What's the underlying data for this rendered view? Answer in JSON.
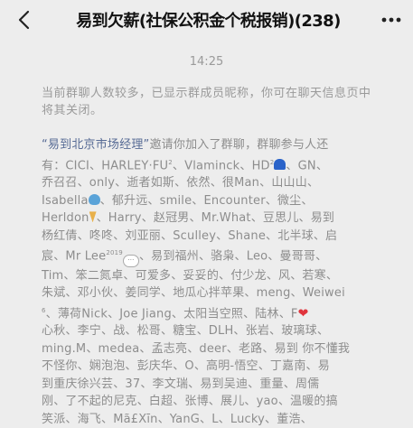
{
  "header": {
    "title": "易到欠薪(社保公积金个税报销)(238)",
    "back_icon": "chevron-left-icon",
    "more_icon": "ellipsis-icon"
  },
  "chat": {
    "timestamp": "14:25",
    "system_notice": "当前群聊人数较多，已显示群成员昵称，你可在聊天信息页中将其关闭。",
    "join_message": {
      "inviter": "“易到北京市场经理”",
      "lines": [
        "邀请你加入了群聊，群聊参与人还",
        "有：CICI、HARLEY·FU",
        "、Vlaminck、HD",
        "、GN、",
        "乔召召、only、逝者如斯、依然、很Man、山山山、",
        "Isabella",
        "、郁升远、smile、Encounter、微尘、",
        "Herldon",
        "、Harry、赵冠男、Mr.What、豆思儿、易到",
        "杨红倩、咚咚、刘亚丽、Sculley、Shane、北半球、启",
        "宸、Mr Lee",
        "、易到福州、骆枭、Leo、曼哥哥、",
        "Tim、笨二氮卓、可爱多、妥妥的、付少龙、风、若寒、",
        "朱斌、邓小伙、姜同学、地瓜心拌苹果、meng、Weiwei",
        "、薄荷Nick、Joe Jiang、太阳当空照、陆林、F",
        "心秋、李宁、战、松哥、糖宝、DLH、张岩、玻璃球、",
        "ming.M、medea、孟志亮、deer、老路、易到 你不懂我",
        "不怪你、娴泡泡、彭庆华、O、高明-悟空、丁嘉南、易",
        "到重庆徐兴芸、37、李文瑞、易到吴迪、重量、周儒",
        "刚、了不起的尼克、白超、张博、展儿、yao、温暖的搞",
        "笑派、海飞、Mã£Xīn、YanG、L、Lucky、董浩、"
      ],
      "sup_2019": "2019",
      "sup_6": "6",
      "sup_2": "2",
      "bubble_text": "···"
    }
  }
}
